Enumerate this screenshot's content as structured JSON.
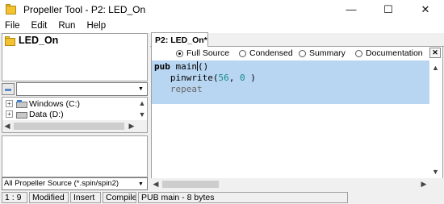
{
  "window": {
    "title": "Propeller Tool - P2: LED_On",
    "minimize": "—",
    "maximize": "☐",
    "close": "✕"
  },
  "menu": [
    "File",
    "Edit",
    "Run",
    "Help"
  ],
  "project": {
    "name": "LED_On"
  },
  "drives": [
    {
      "label": "Windows (C:)",
      "expander": "+"
    },
    {
      "label": "Data (D:)",
      "expander": "+"
    }
  ],
  "filter": {
    "value": "All Propeller Source (*.spin/spin2)"
  },
  "editor": {
    "tab_label": "P2: LED_On*",
    "views": [
      {
        "label": "Full Source",
        "selected": true
      },
      {
        "label": "Condensed",
        "selected": false
      },
      {
        "label": "Summary",
        "selected": false
      },
      {
        "label": "Documentation",
        "selected": false
      }
    ],
    "close_label": "✕",
    "code": {
      "line1_kw": "pub",
      "line1_name": "main",
      "line1_parens": "()",
      "line2_fn": "pinwrite",
      "line2_open": "(",
      "line2_arg1": "56",
      "line2_sep": ", ",
      "line2_arg2": "0",
      "line2_close": " )",
      "line3": "repeat"
    }
  },
  "status": {
    "position": "1 : 9",
    "modified": "Modified",
    "mode": "Insert",
    "compiled": "Compiled",
    "info": "PUB main  - 8 bytes"
  },
  "icons": {
    "app": "propeller-folder-icon",
    "scroll_left": "◀",
    "scroll_right": "▶",
    "scroll_up": "▲",
    "scroll_down": "▼",
    "combo": "▼"
  }
}
